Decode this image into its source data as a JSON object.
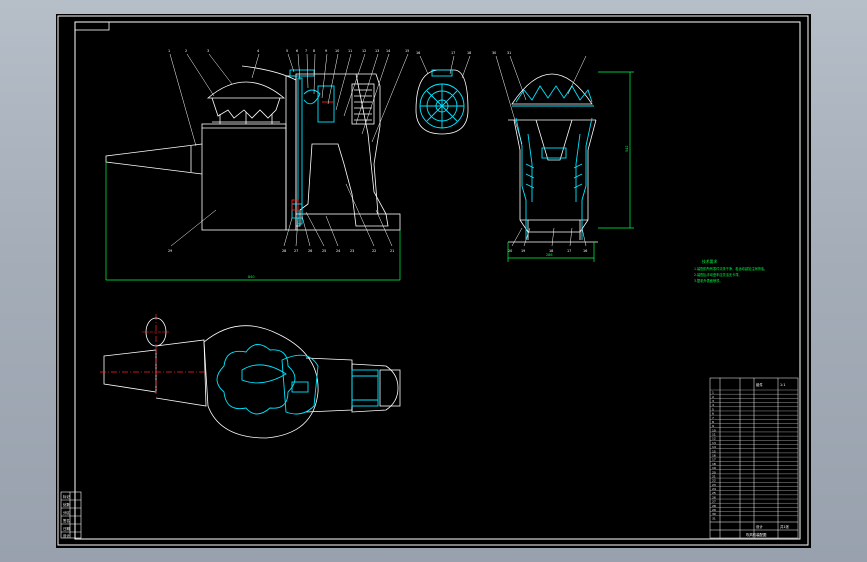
{
  "drawing": {
    "background_color": "#000000",
    "frame_color": "#ffffff",
    "part_color": "#ffffff",
    "cyan_color": "#00e5ff",
    "dimension_color": "#00ff44",
    "leader_color": "#ffffff",
    "centerline_color": "#ff2020"
  },
  "front_view": {
    "balloons": [
      "1",
      "2",
      "3",
      "4",
      "5",
      "6",
      "7",
      "8",
      "9",
      "10",
      "11",
      "12",
      "13",
      "14",
      "15"
    ],
    "bottom_balloons": [
      "28",
      "27",
      "26",
      "25",
      "24",
      "23",
      "22",
      "21"
    ],
    "side_balloon": "29",
    "width_dim": "840"
  },
  "side_view": {
    "balloons": [
      "16",
      "17",
      "18"
    ],
    "bottom_balloons": [
      "20",
      "19",
      "18",
      "17",
      "16"
    ],
    "height_dim": "542",
    "width_dim": "286",
    "top_balloons": [
      "30",
      "31"
    ]
  },
  "tech_notes": {
    "title": "技术要求",
    "lines": [
      "1.装配前所有零件清洗干净，各运动副加注润滑油。",
      "2.装配后手动盘车应灵活无卡滞。",
      "3.整机外表面喷漆。"
    ]
  },
  "title_block": {
    "drawing_title": "吹风机装配图",
    "material": "组件",
    "scale": "1:1",
    "sheet": "共1张",
    "designer": "设计",
    "rows": [
      "1",
      "2",
      "3",
      "4",
      "5",
      "6",
      "7",
      "8",
      "9",
      "10",
      "11",
      "12",
      "13",
      "14",
      "15",
      "16",
      "17",
      "18",
      "19",
      "20",
      "21",
      "22",
      "23",
      "24",
      "25",
      "26",
      "27",
      "28",
      "29",
      "30",
      "31"
    ]
  },
  "revision_block": {
    "labels": [
      "标记",
      "处数",
      "分区",
      "签名",
      "日期",
      "设计"
    ]
  }
}
